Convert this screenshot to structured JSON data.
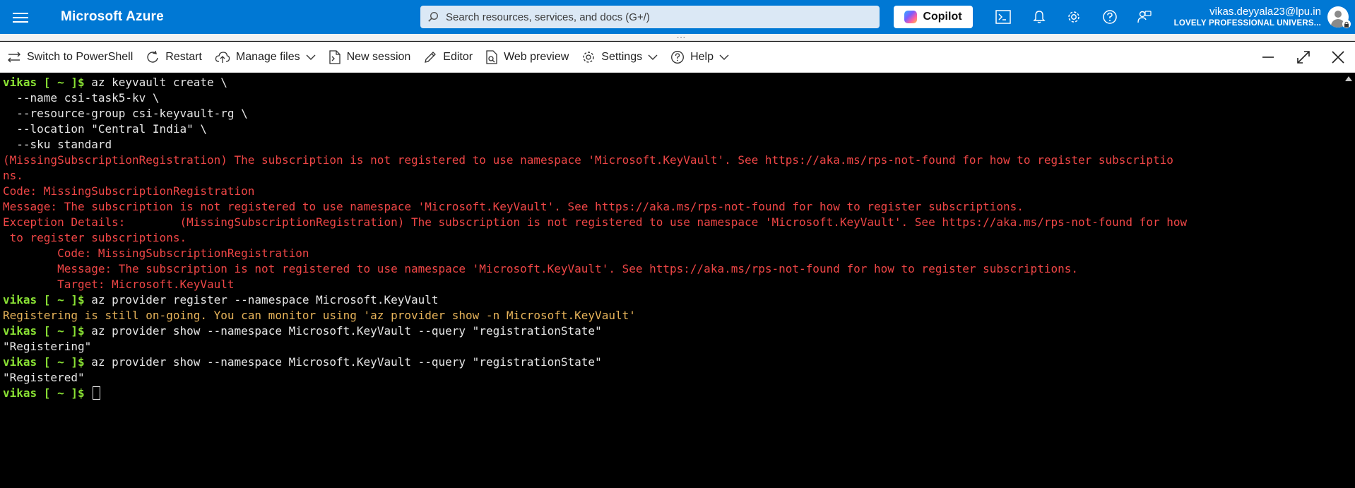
{
  "topbar": {
    "brand": "Microsoft Azure",
    "search_placeholder": "Search resources, services, and docs (G+/)",
    "copilot_label": "Copilot",
    "user_email": "vikas.deyyala23@lpu.in",
    "user_org": "LOVELY PROFESSIONAL UNIVERS...",
    "icons": [
      "cloud-shell-icon",
      "bell-icon",
      "gear-icon",
      "help-icon",
      "feedback-icon"
    ]
  },
  "drag_handle": "...",
  "toolbar": {
    "switch": "Switch to PowerShell",
    "restart": "Restart",
    "manage_files": "Manage files",
    "new_session": "New session",
    "editor": "Editor",
    "web_preview": "Web preview",
    "settings": "Settings",
    "help": "Help"
  },
  "terminal": {
    "prompt": "vikas [ ~ ]$ ",
    "lines": [
      {
        "type": "cmd",
        "prompt": true,
        "text": "az keyvault create \\"
      },
      {
        "type": "cmd",
        "prompt": false,
        "text": "  --name csi-task5-kv \\"
      },
      {
        "type": "cmd",
        "prompt": false,
        "text": "  --resource-group csi-keyvault-rg \\"
      },
      {
        "type": "cmd",
        "prompt": false,
        "text": "  --location \"Central India\" \\"
      },
      {
        "type": "cmd",
        "prompt": false,
        "text": "  --sku standard"
      },
      {
        "type": "err",
        "text": "(MissingSubscriptionRegistration) The subscription is not registered to use namespace 'Microsoft.KeyVault'. See https://aka.ms/rps-not-found for how to register subscriptio"
      },
      {
        "type": "err",
        "text": "ns."
      },
      {
        "type": "err",
        "text": "Code: MissingSubscriptionRegistration"
      },
      {
        "type": "err",
        "text": "Message: The subscription is not registered to use namespace 'Microsoft.KeyVault'. See https://aka.ms/rps-not-found for how to register subscriptions."
      },
      {
        "type": "err",
        "text": "Exception Details:\t(MissingSubscriptionRegistration) The subscription is not registered to use namespace 'Microsoft.KeyVault'. See https://aka.ms/rps-not-found for how"
      },
      {
        "type": "err",
        "text": " to register subscriptions."
      },
      {
        "type": "err",
        "text": "\tCode: MissingSubscriptionRegistration"
      },
      {
        "type": "err",
        "text": "\tMessage: The subscription is not registered to use namespace 'Microsoft.KeyVault'. See https://aka.ms/rps-not-found for how to register subscriptions."
      },
      {
        "type": "err",
        "text": "\tTarget: Microsoft.KeyVault"
      },
      {
        "type": "cmd",
        "prompt": true,
        "text": "az provider register --namespace Microsoft.KeyVault"
      },
      {
        "type": "warn",
        "text": "Registering is still on-going. You can monitor using 'az provider show -n Microsoft.KeyVault'"
      },
      {
        "type": "cmd",
        "prompt": true,
        "text": "az provider show --namespace Microsoft.KeyVault --query \"registrationState\""
      },
      {
        "type": "out",
        "text": "\"Registering\""
      },
      {
        "type": "cmd",
        "prompt": true,
        "text": "az provider show --namespace Microsoft.KeyVault --query \"registrationState\""
      },
      {
        "type": "out",
        "text": "\"Registered\""
      },
      {
        "type": "cmd",
        "prompt": true,
        "text": "",
        "cursor": true
      }
    ]
  },
  "colors": {
    "azure_blue": "#0078d4",
    "prompt_green": "#8ae234",
    "error_red": "#ef4646",
    "warning_orange": "#e8b45a"
  }
}
